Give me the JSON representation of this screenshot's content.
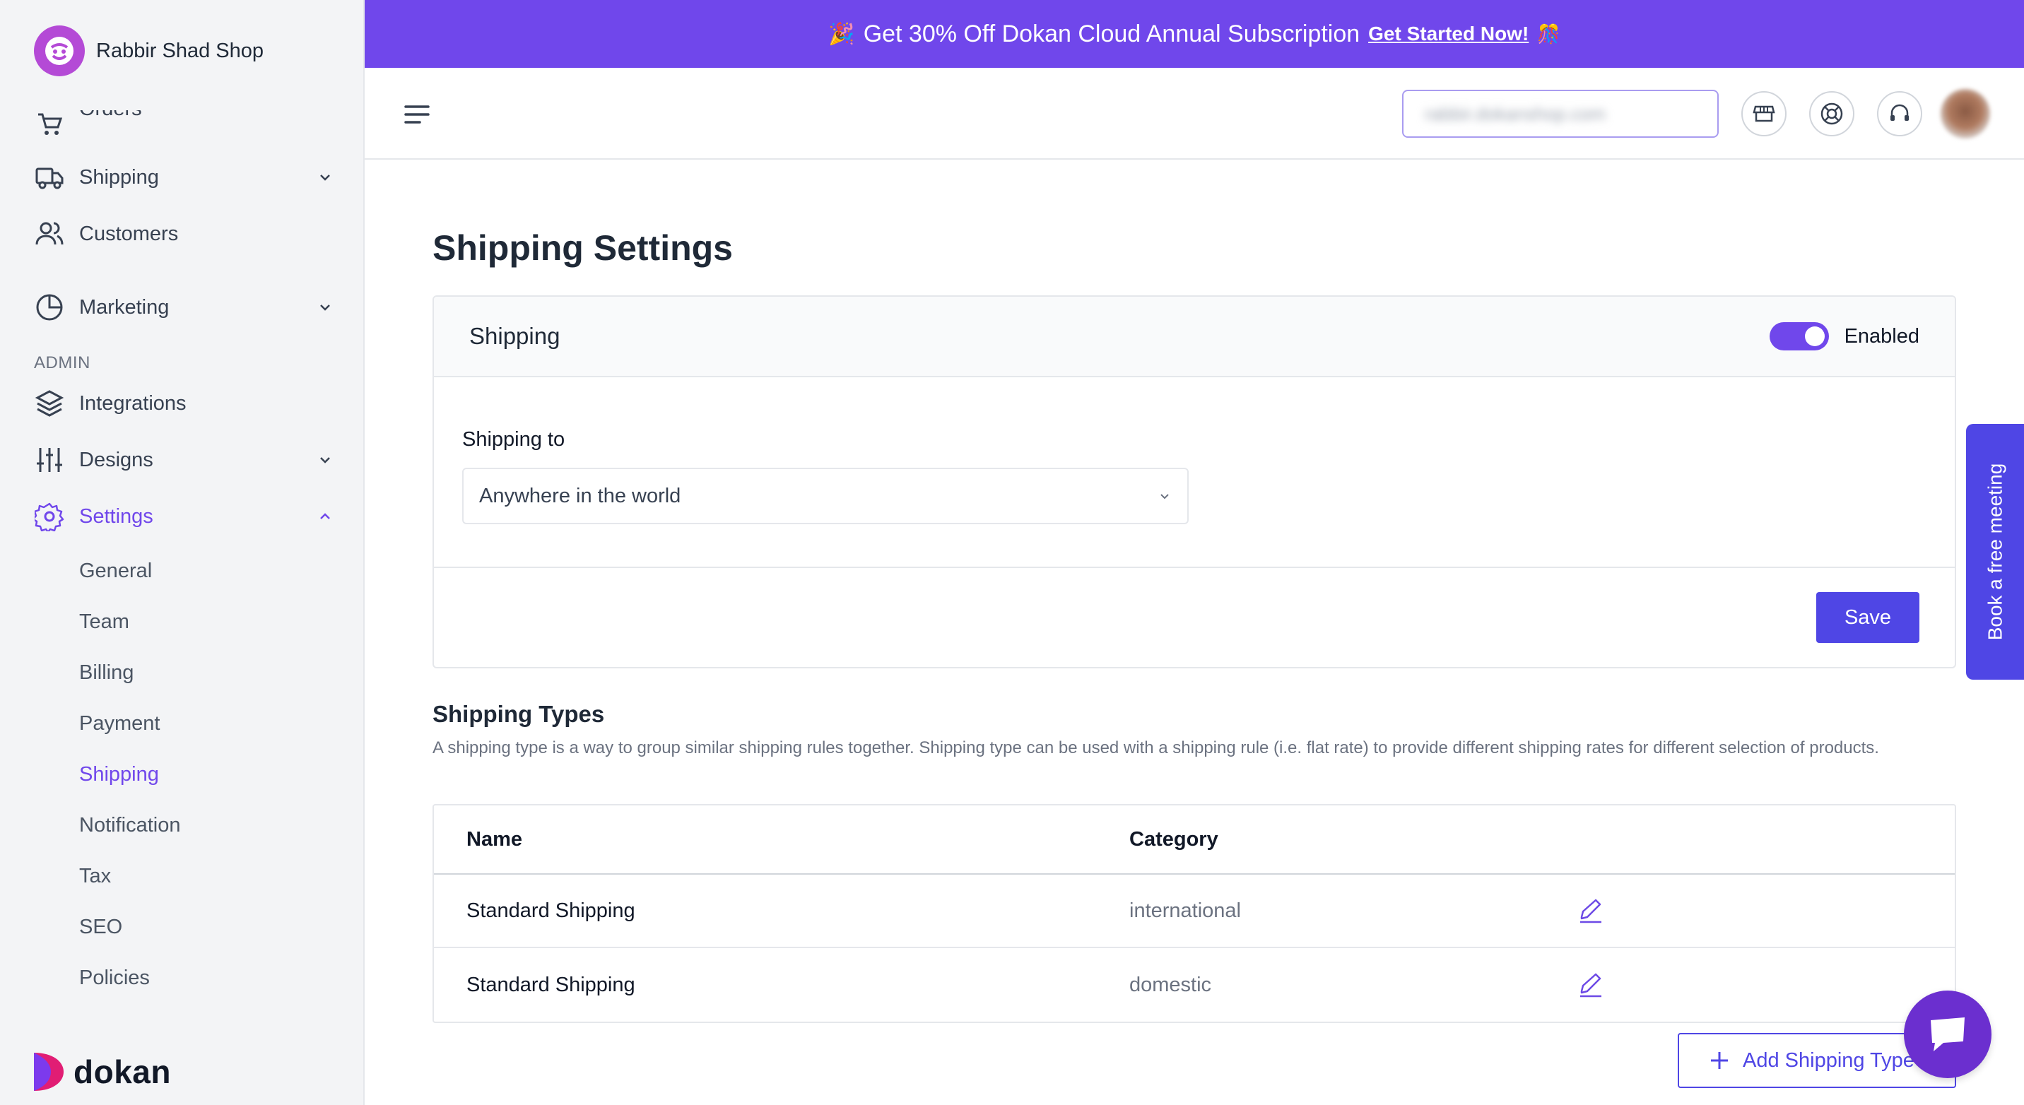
{
  "brand": {
    "name": "Rabbir Shad Shop",
    "footer_word": "dokan"
  },
  "sidebar": {
    "items": [
      {
        "label": "Orders"
      },
      {
        "label": "Shipping"
      },
      {
        "label": "Customers"
      },
      {
        "label": "Marketing"
      },
      {
        "label": "Integrations"
      },
      {
        "label": "Designs"
      },
      {
        "label": "Settings"
      }
    ],
    "section_admin": "ADMIN",
    "settings_sub": [
      "General",
      "Team",
      "Billing",
      "Payment",
      "Shipping",
      "Notification",
      "Tax",
      "SEO",
      "Policies"
    ],
    "active_sub": "Shipping"
  },
  "promo": {
    "text": "Get 30% Off Dokan Cloud Annual Subscription",
    "link": "Get Started Now!"
  },
  "header": {
    "search_text": "rabbir.dokanshop.com"
  },
  "page": {
    "title": "Shipping Settings"
  },
  "shipping_card": {
    "title": "Shipping",
    "toggle_label": "Enabled",
    "toggle_on": true,
    "field_label": "Shipping to",
    "field_value": "Anywhere in the world",
    "save_label": "Save"
  },
  "shipping_types": {
    "title": "Shipping Types",
    "description": "A shipping type is a way to group similar shipping rules together. Shipping type can be used with a shipping rule (i.e. flat rate) to provide different shipping rates for different selection of products.",
    "columns": [
      "Name",
      "Category"
    ],
    "rows": [
      {
        "name": "Standard Shipping",
        "category": "international"
      },
      {
        "name": "Standard Shipping",
        "category": "domestic"
      }
    ],
    "add_label": "Add Shipping Type"
  },
  "widgets": {
    "meeting": "Book a free meeting"
  },
  "colors": {
    "accent": "#7047eb",
    "primary_button": "#4f46e5",
    "chat": "#6b2fcf"
  }
}
